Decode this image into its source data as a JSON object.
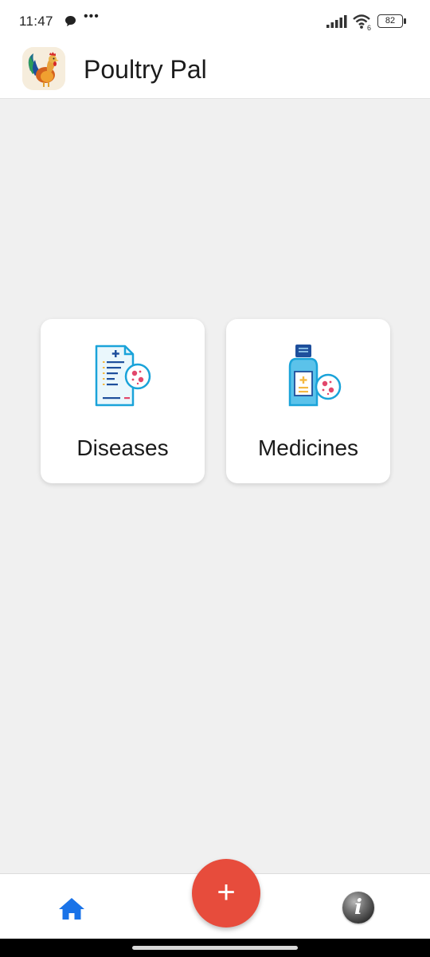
{
  "status_bar": {
    "time": "11:47",
    "dots": "•••",
    "wifi_badge": "6",
    "battery": "82"
  },
  "app_bar": {
    "title": "Poultry Pal",
    "logo_icon": "rooster-logo"
  },
  "categories": [
    {
      "label": "Diseases",
      "icon": "medical-report-virus-icon"
    },
    {
      "label": "Medicines",
      "icon": "medicine-bottle-virus-icon"
    }
  ],
  "bottom_nav": {
    "home_icon": "home-icon",
    "fab_label": "+",
    "info_label": "i",
    "fab_color": "#e74c3c",
    "home_color": "#1a73e8"
  }
}
